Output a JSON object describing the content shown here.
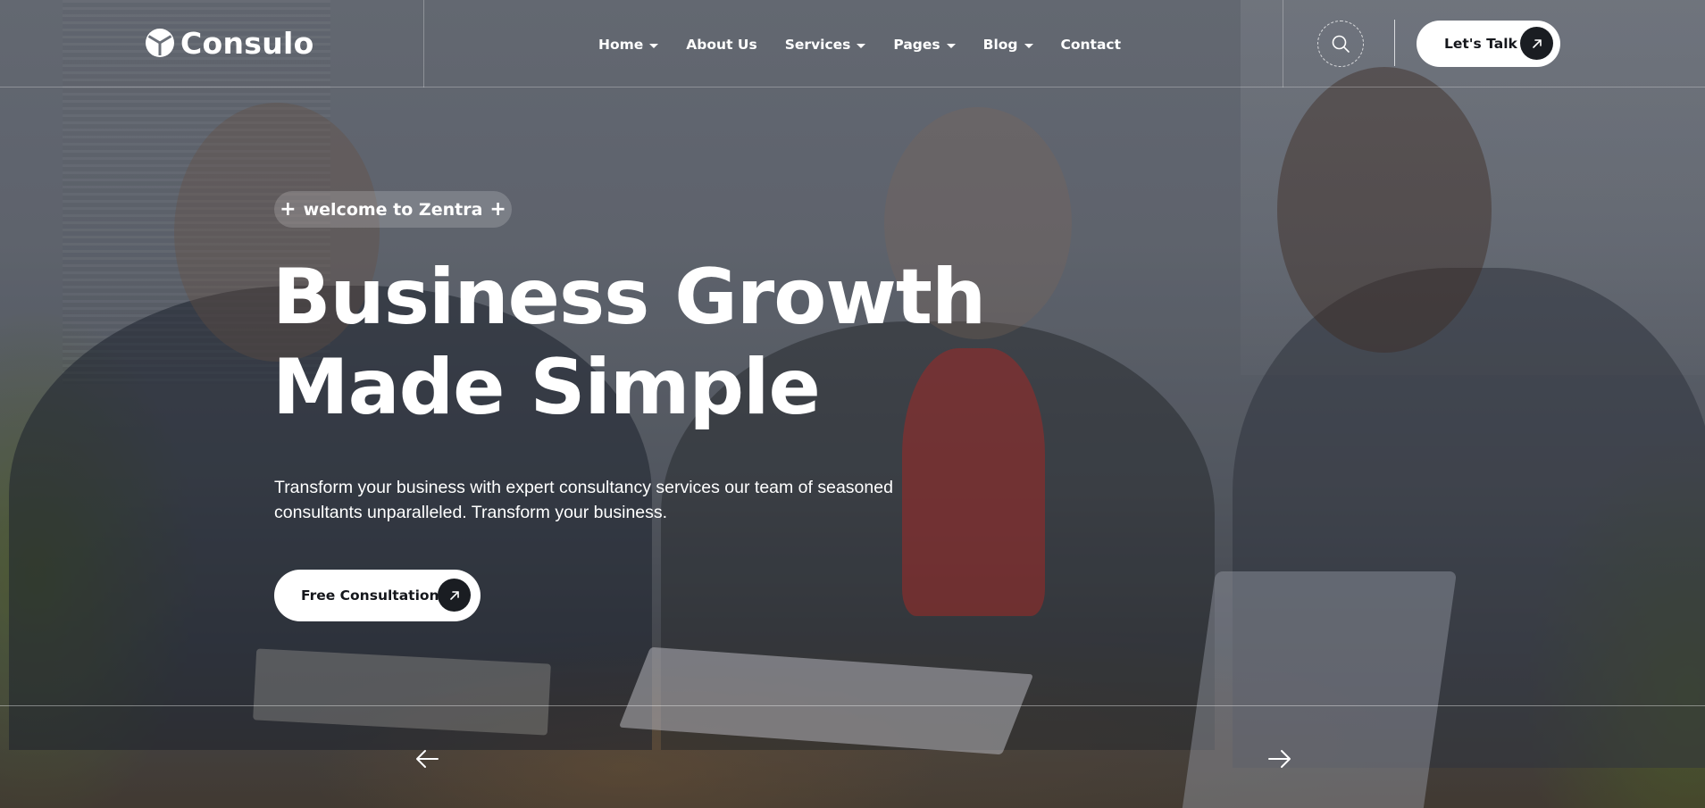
{
  "brand": {
    "name": "Consulo"
  },
  "nav": {
    "items": [
      {
        "label": "Home",
        "has_dropdown": true
      },
      {
        "label": "About Us",
        "has_dropdown": false
      },
      {
        "label": "Services",
        "has_dropdown": true
      },
      {
        "label": "Pages",
        "has_dropdown": true
      },
      {
        "label": "Blog",
        "has_dropdown": true
      },
      {
        "label": "Contact",
        "has_dropdown": false
      }
    ]
  },
  "header_actions": {
    "search_icon": "search-icon",
    "talk_label": "Let's Talk",
    "talk_icon": "arrow-up-right-icon"
  },
  "hero": {
    "eyebrow": "welcome to Zentra",
    "eyebrow_icon": "plus-icon",
    "headline_line1": "Business Growth",
    "headline_line2": "Made Simple",
    "description": "Transform your business with expert consultancy services our team of seasoned consultants unparalleled. Transform your business.",
    "cta_label": "Free Consultation",
    "cta_icon": "arrow-up-right-icon"
  },
  "slider": {
    "prev_icon": "arrow-left-icon",
    "next_icon": "arrow-right-icon"
  },
  "colors": {
    "button_bg": "#ffffff",
    "button_text": "#15171c",
    "arrow_circle": "#1a1d22",
    "text": "#ffffff"
  }
}
